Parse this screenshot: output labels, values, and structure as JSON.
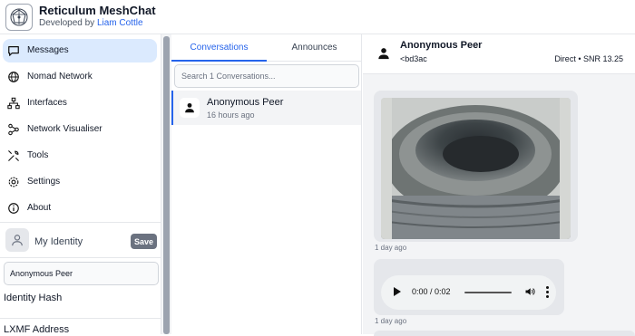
{
  "app": {
    "title": "Reticulum MeshChat",
    "subtitle_prefix": "Developed by",
    "author": "Liam Cottle"
  },
  "sidebar": {
    "items": [
      {
        "label": "Messages",
        "icon": "chat-bubble-icon",
        "active": true
      },
      {
        "label": "Nomad Network",
        "icon": "globe-icon"
      },
      {
        "label": "Interfaces",
        "icon": "network-icon"
      },
      {
        "label": "Network Visualiser",
        "icon": "graph-icon"
      },
      {
        "label": "Tools",
        "icon": "wrench-icon"
      },
      {
        "label": "Settings",
        "icon": "gear-icon"
      },
      {
        "label": "About",
        "icon": "info-icon"
      }
    ],
    "identity": {
      "label": "My Identity",
      "save_label": "Save",
      "display_name": "Anonymous Peer",
      "hash_label": "Identity Hash",
      "lxmf_label": "LXMF Address"
    }
  },
  "conversations": {
    "tabs": [
      {
        "label": "Conversations",
        "active": true
      },
      {
        "label": "Announces",
        "active": false
      }
    ],
    "search_placeholder": "Search 1 Conversations...",
    "items": [
      {
        "name": "Anonymous Peer",
        "time": "16 hours ago"
      }
    ]
  },
  "chat": {
    "peer_name": "Anonymous Peer",
    "peer_hash": "<bd3ac",
    "status": "Direct • SNR 13.25",
    "messages": [
      {
        "type": "image",
        "time": "1 day ago",
        "image": "tyre-photo"
      },
      {
        "type": "audio",
        "time": "1 day ago",
        "audio_time": "0:00 / 0:02"
      }
    ]
  },
  "colors": {
    "accent": "#2563eb",
    "active_nav_bg": "#dbeafe",
    "chat_bg": "#f3f4f6",
    "bubble": "#e5e7eb"
  }
}
